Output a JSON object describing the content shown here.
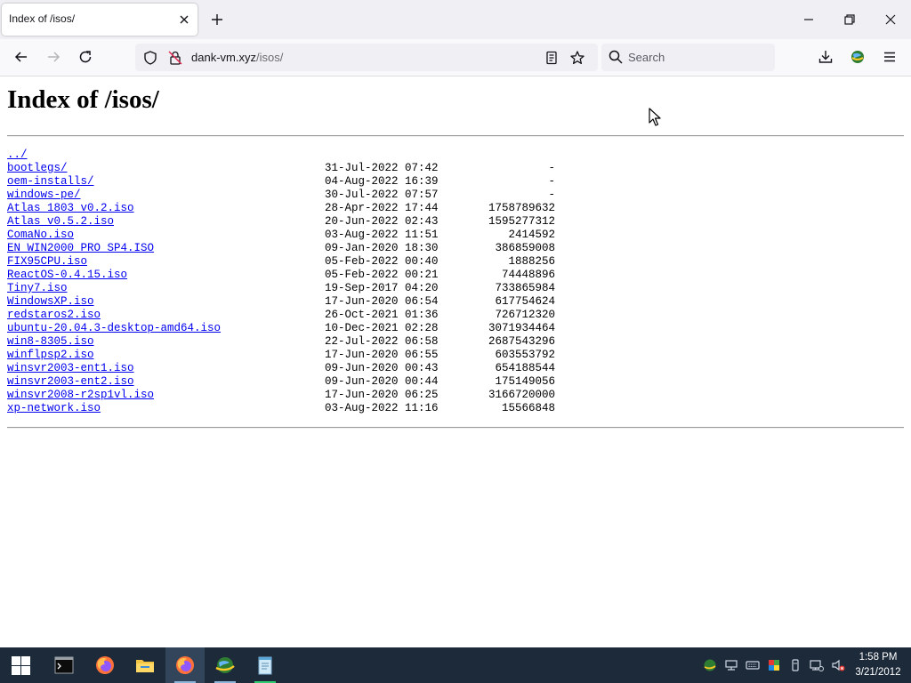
{
  "tab": {
    "title": "Index of /isos/"
  },
  "navbar": {
    "url_domain": "dank-vm.xyz",
    "url_path": "/isos/",
    "search_placeholder": "Search"
  },
  "page": {
    "heading": "Index of /isos/",
    "entries": [
      {
        "name": "../",
        "date": "",
        "size": ""
      },
      {
        "name": "bootlegs/",
        "date": "31-Jul-2022 07:42",
        "size": "-"
      },
      {
        "name": "oem-installs/",
        "date": "04-Aug-2022 16:39",
        "size": "-"
      },
      {
        "name": "windows-pe/",
        "date": "30-Jul-2022 07:57",
        "size": "-"
      },
      {
        "name": "Atlas_1803_v0.2.iso",
        "date": "28-Apr-2022 17:44",
        "size": "1758789632"
      },
      {
        "name": "Atlas_v0.5.2.iso",
        "date": "20-Jun-2022 02:43",
        "size": "1595277312"
      },
      {
        "name": "ComaNo.iso",
        "date": "03-Aug-2022 11:51",
        "size": "2414592"
      },
      {
        "name": "EN_WIN2000_PRO_SP4.ISO",
        "date": "09-Jan-2020 18:30",
        "size": "386859008"
      },
      {
        "name": "FIX95CPU.iso",
        "date": "05-Feb-2022 00:40",
        "size": "1888256"
      },
      {
        "name": "ReactOS-0.4.15.iso",
        "date": "05-Feb-2022 00:21",
        "size": "74448896"
      },
      {
        "name": "Tiny7.iso",
        "date": "19-Sep-2017 04:20",
        "size": "733865984"
      },
      {
        "name": "WindowsXP.iso",
        "date": "17-Jun-2020 06:54",
        "size": "617754624"
      },
      {
        "name": "redstaros2.iso",
        "date": "26-Oct-2021 01:36",
        "size": "726712320"
      },
      {
        "name": "ubuntu-20.04.3-desktop-amd64.iso",
        "date": "10-Dec-2021 02:28",
        "size": "3071934464"
      },
      {
        "name": "win8-8305.iso",
        "date": "22-Jul-2022 06:58",
        "size": "2687543296"
      },
      {
        "name": "winflpsp2.iso",
        "date": "17-Jun-2020 06:55",
        "size": "603553792"
      },
      {
        "name": "winsvr2003-ent1.iso",
        "date": "09-Jun-2020 00:43",
        "size": "654188544"
      },
      {
        "name": "winsvr2003-ent2.iso",
        "date": "09-Jun-2020 00:44",
        "size": "175149056"
      },
      {
        "name": "winsvr2008-r2sp1vl.iso",
        "date": "17-Jun-2020 06:25",
        "size": "3166720000"
      },
      {
        "name": "xp-network.iso",
        "date": "03-Aug-2022 11:16",
        "size": "15566848"
      }
    ]
  },
  "taskbar": {
    "time": "1:58 PM",
    "date": "3/21/2012",
    "apps": [
      "terminal-icon",
      "firefox-icon",
      "file-explorer-icon",
      "firefox-icon",
      "network-globe-icon",
      "notepad-icon"
    ]
  },
  "colors": {
    "link": "#0000ee",
    "taskbar": "#1d2a3a",
    "firefox_orange": "#ff7139"
  }
}
